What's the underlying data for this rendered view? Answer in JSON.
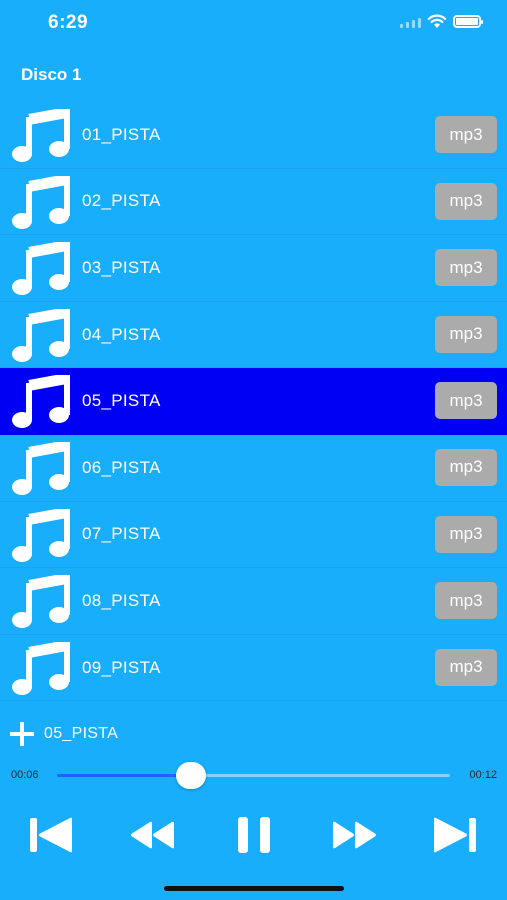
{
  "status_bar": {
    "time": "6:29"
  },
  "section_title": "Disco 1",
  "tracks": [
    {
      "name": "01_PISTA",
      "format": "mp3"
    },
    {
      "name": "02_PISTA",
      "format": "mp3"
    },
    {
      "name": "03_PISTA",
      "format": "mp3"
    },
    {
      "name": "04_PISTA",
      "format": "mp3"
    },
    {
      "name": "05_PISTA",
      "format": "mp3"
    },
    {
      "name": "06_PISTA",
      "format": "mp3"
    },
    {
      "name": "07_PISTA",
      "format": "mp3"
    },
    {
      "name": "08_PISTA",
      "format": "mp3"
    },
    {
      "name": "09_PISTA",
      "format": "mp3"
    }
  ],
  "selected_track_index": 4,
  "now_playing": "05_PISTA",
  "player": {
    "elapsed": "00:06",
    "total": "00:12",
    "progress": 0.34
  },
  "colors": {
    "background": "#19aefc",
    "selected_row": "#0000f5",
    "badge": "#ababab",
    "slider_fill": "#1c64ff"
  },
  "icons": {
    "track": "music-note-icon",
    "add": "plus-icon",
    "controls": [
      "skip-previous-icon",
      "rewind-icon",
      "pause-icon",
      "fast-forward-icon",
      "skip-next-icon"
    ]
  }
}
